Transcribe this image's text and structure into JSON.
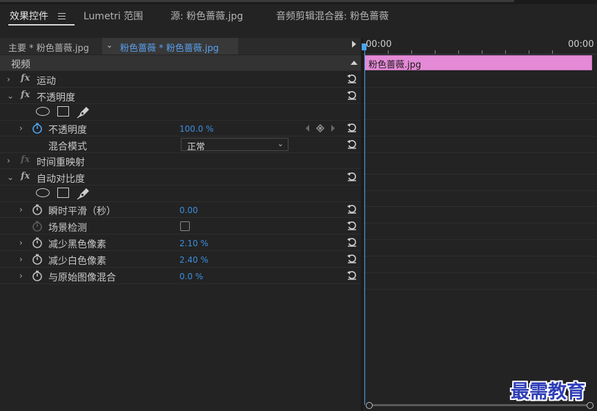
{
  "tabs": [
    {
      "label": "效果控件",
      "active": true
    },
    {
      "label": "Lumetri 范围",
      "active": false
    },
    {
      "label": "源: 粉色蔷薇.jpg",
      "active": false
    },
    {
      "label": "音频剪辑混合器: 粉色蔷薇",
      "active": false
    }
  ],
  "source": {
    "master": "主要 * 粉色蔷薇.jpg",
    "clip": "粉色蔷薇 * 粉色蔷薇.jpg"
  },
  "effects": {
    "section_video": "视频",
    "motion": "运动",
    "opacity": {
      "name": "不透明度",
      "param_opacity_label": "不透明度",
      "param_opacity_value": "100.0 %",
      "blend_mode_label": "混合模式",
      "blend_mode_value": "正常"
    },
    "time_remap": "时间重映射",
    "auto_contrast": {
      "name": "自动对比度",
      "temporal_smoothing_label": "瞬时平滑（秒）",
      "temporal_smoothing_value": "0.00",
      "scene_detect_label": "场景检测",
      "scene_detect_checked": false,
      "black_clip_label": "减少黑色像素",
      "black_clip_value": "2.10 %",
      "white_clip_label": "减少白色像素",
      "white_clip_value": "2.40 %",
      "blend_original_label": "与原始图像混合",
      "blend_original_value": "0.0 %"
    }
  },
  "timeline": {
    "timecode_start": "00:00",
    "timecode_end": "00:00",
    "clip_name": "粉色蔷薇.jpg",
    "clip_color": "#e48ad6",
    "playhead_color": "#4aa3f0"
  },
  "watermark": "最需教育",
  "colors": {
    "accent_value": "#3d8fe0",
    "panel_bg": "#232323",
    "header_bg": "#333333"
  }
}
